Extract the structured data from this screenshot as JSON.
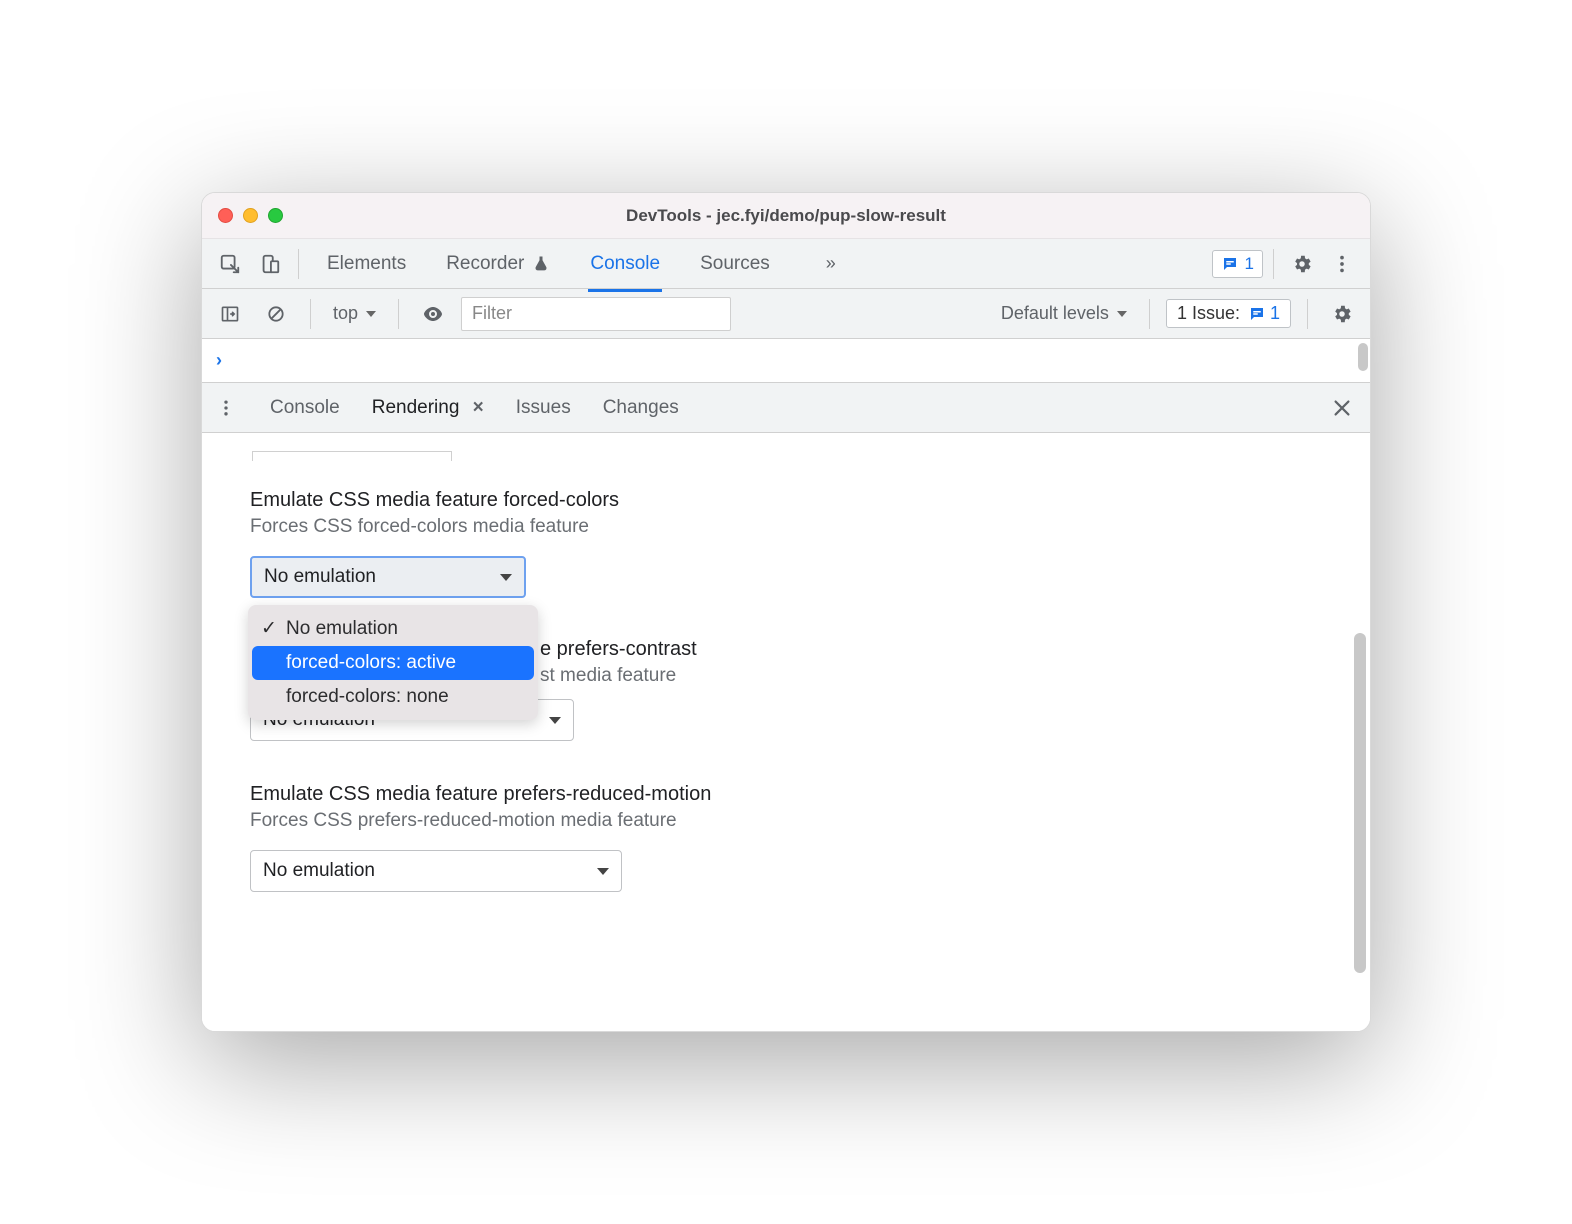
{
  "window": {
    "title": "DevTools - jec.fyi/demo/pup-slow-result"
  },
  "maintabs": {
    "elements": "Elements",
    "recorder": "Recorder",
    "console": "Console",
    "sources": "Sources",
    "more_glyph": "»"
  },
  "issues": {
    "top_count": "1"
  },
  "console_toolbar": {
    "context": "top",
    "filter_placeholder": "Filter",
    "levels": "Default levels",
    "issue_label": "1 Issue:",
    "issue_count": "1"
  },
  "console_prompt": "›",
  "drawer": {
    "console": "Console",
    "rendering": "Rendering",
    "issues": "Issues",
    "changes": "Changes",
    "close_glyph": "×"
  },
  "rendering": {
    "forced_colors": {
      "title": "Emulate CSS media feature forced-colors",
      "sub": "Forces CSS forced-colors media feature",
      "value": "No emulation",
      "options": {
        "o1": "No emulation",
        "o2": "forced-colors: active",
        "o3": "forced-colors: none"
      },
      "checkmark": "✓"
    },
    "prefers_contrast": {
      "title_frag": "e prefers-contrast",
      "sub_frag": "st media feature",
      "value": "No emulation"
    },
    "prefers_reduced_motion": {
      "title": "Emulate CSS media feature prefers-reduced-motion",
      "sub": "Forces CSS prefers-reduced-motion media feature",
      "value": "No emulation"
    }
  }
}
